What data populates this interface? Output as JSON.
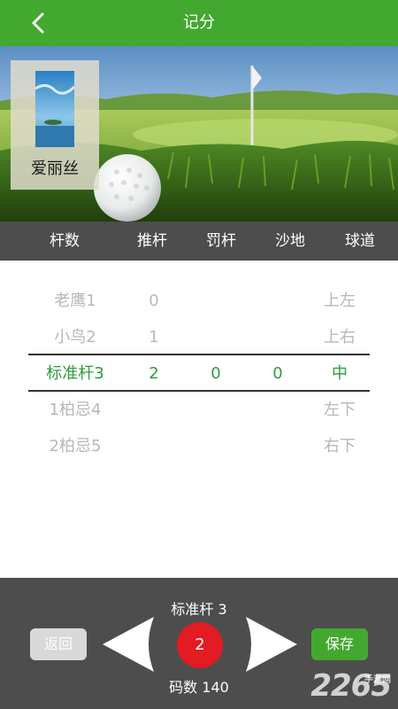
{
  "header": {
    "title": "记分"
  },
  "player": {
    "name": "爱丽丝"
  },
  "columns": {
    "strokes": "杆数",
    "putts": "推杆",
    "penalty": "罚杆",
    "sand": "沙地",
    "fairway": "球道"
  },
  "rows": [
    {
      "name": "老鹰1",
      "putts": "0",
      "penalty": "",
      "sand": "",
      "fairway": "上左"
    },
    {
      "name": "小鸟2",
      "putts": "1",
      "penalty": "",
      "sand": "",
      "fairway": "上右"
    },
    {
      "name": "标准杆3",
      "putts": "2",
      "penalty": "0",
      "sand": "0",
      "fairway": "中"
    },
    {
      "name": "1柏忌4",
      "putts": "",
      "penalty": "",
      "sand": "",
      "fairway": "左下"
    },
    {
      "name": "2柏忌5",
      "putts": "",
      "penalty": "",
      "sand": "",
      "fairway": "右下"
    }
  ],
  "selected_row": 2,
  "bottom": {
    "par_label": "标准杆 3",
    "hole_number": "2",
    "yardage_label": "码数 140",
    "back_label": "返回",
    "save_label": "保存"
  },
  "watermark": {
    "number": "2265",
    "suffix": "手游网"
  },
  "colors": {
    "accent_green": "#43a830",
    "selected_text": "#2f9b3f",
    "dark_bar": "#4d4d4d",
    "hole_red": "#e31b23"
  }
}
